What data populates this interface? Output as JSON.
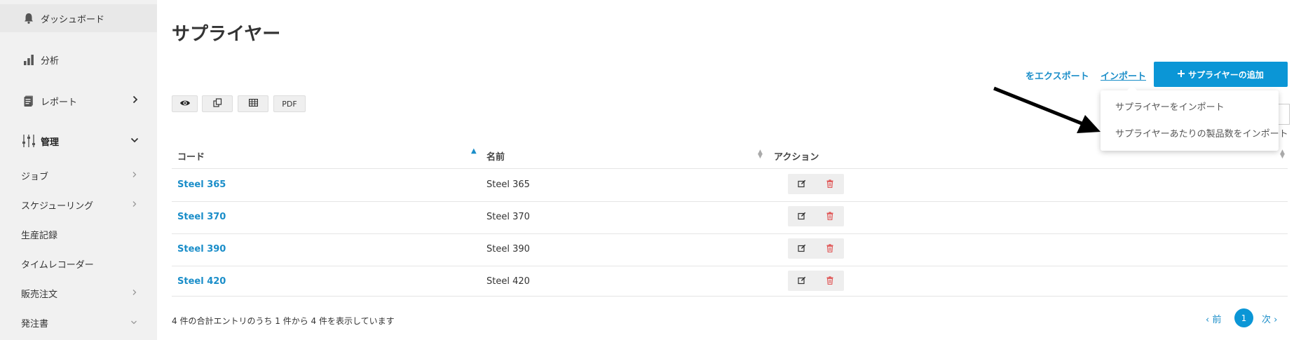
{
  "sidebar": {
    "items": [
      {
        "label": "ダッシュボード",
        "icon": "bell-icon"
      },
      {
        "label": "分析",
        "icon": "bar-chart-icon"
      },
      {
        "label": "レポート",
        "icon": "document-icon"
      },
      {
        "label": "管理",
        "icon": "sliders-icon"
      }
    ],
    "sub_items": [
      {
        "label": "ジョブ"
      },
      {
        "label": "スケジューリング"
      },
      {
        "label": "生産記録"
      },
      {
        "label": "タイムレコーダー"
      },
      {
        "label": "販売注文"
      },
      {
        "label": "発注書"
      }
    ]
  },
  "page": {
    "title": "サプライヤー"
  },
  "actions": {
    "export_label": "をエクスポート",
    "import_label": "インポート",
    "add_label": "サプライヤーの追加"
  },
  "toolbar": {
    "pdf_label": "PDF"
  },
  "import_menu": {
    "items": [
      "サプライヤーをインポート",
      "サプライヤーあたりの製品数をインポート"
    ]
  },
  "table": {
    "headers": [
      "コード",
      "名前",
      "アクション"
    ],
    "rows": [
      {
        "code": "Steel 365",
        "name": "Steel 365"
      },
      {
        "code": "Steel 370",
        "name": "Steel 370"
      },
      {
        "code": "Steel 390",
        "name": "Steel 390"
      },
      {
        "code": "Steel 420",
        "name": "Steel 420"
      }
    ]
  },
  "footer": {
    "summary": "4 件の合計エントリのうち 1 件から 4 件を表示しています",
    "prev_label": "‹ 前",
    "current_page": "1",
    "next_label": "次 ›"
  },
  "colors": {
    "accent": "#0b96d6",
    "link": "#1b8ec9",
    "delete": "#e05555"
  }
}
